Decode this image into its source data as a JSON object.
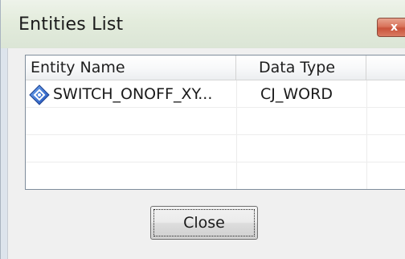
{
  "window": {
    "title": "Entities List",
    "close_glyph": "x"
  },
  "list": {
    "columns": [
      {
        "label": "Entity Name"
      },
      {
        "label": "Data Type"
      },
      {
        "label": ""
      }
    ],
    "rows": [
      {
        "name": "SWITCH_ONOFF_XY...",
        "type": "CJ_WORD",
        "icon": "entity-diamond-icon"
      }
    ]
  },
  "buttons": {
    "close_label": "Close"
  },
  "colors": {
    "title_bar": "#e3ecdc",
    "close_x": "#c9533b",
    "icon_blue": "#2f6fd6"
  }
}
